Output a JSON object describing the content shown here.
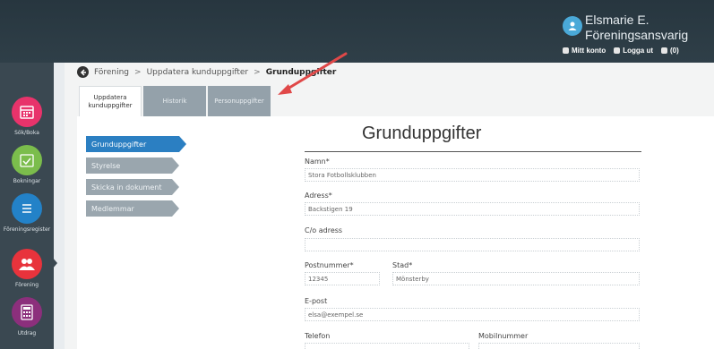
{
  "user": {
    "name": "Elsmarie E.",
    "role": "Föreningsansvarig",
    "links": [
      "Mitt konto",
      "Logga ut",
      "(0)"
    ]
  },
  "leftnav": [
    {
      "label": "Sök/Boka",
      "color": "#e8336b"
    },
    {
      "label": "Bokningar",
      "color": "#7bbd4c"
    },
    {
      "label": "Föreningsregister",
      "color": "#2382c8"
    },
    {
      "label": "Förening",
      "color": "#e8333c"
    },
    {
      "label": "Utdrag",
      "color": "#8c2f7c"
    }
  ],
  "breadcrumb": {
    "items": [
      "Förening",
      "Uppdatera kunduppgifter"
    ],
    "current": "Grunduppgifter",
    "separator": ">"
  },
  "tabs": [
    {
      "label": "Uppdatera kunduppgifter",
      "active": true
    },
    {
      "label": "Historik",
      "active": false
    },
    {
      "label": "Personuppgifter",
      "active": false
    }
  ],
  "sidemenu": [
    {
      "label": "Grunduppgifter",
      "active": true
    },
    {
      "label": "Styrelse",
      "active": false
    },
    {
      "label": "Skicka in dokument",
      "active": false
    },
    {
      "label": "Medlemmar",
      "active": false
    }
  ],
  "form": {
    "title": "Grunduppgifter",
    "fields": {
      "namn": {
        "label": "Namn*",
        "value": "Stora Fotbollsklubben"
      },
      "adress": {
        "label": "Adress*",
        "value": "Backstigen 19"
      },
      "co": {
        "label": "C/o adress",
        "value": ""
      },
      "postnummer": {
        "label": "Postnummer*",
        "value": "12345"
      },
      "stad": {
        "label": "Stad*",
        "value": "Mönsterby"
      },
      "epost": {
        "label": "E-post",
        "value": "elsa@exempel.se"
      },
      "telefon": {
        "label": "Telefon",
        "value": ""
      },
      "mobil": {
        "label": "Mobilnummer",
        "value": ""
      }
    }
  }
}
